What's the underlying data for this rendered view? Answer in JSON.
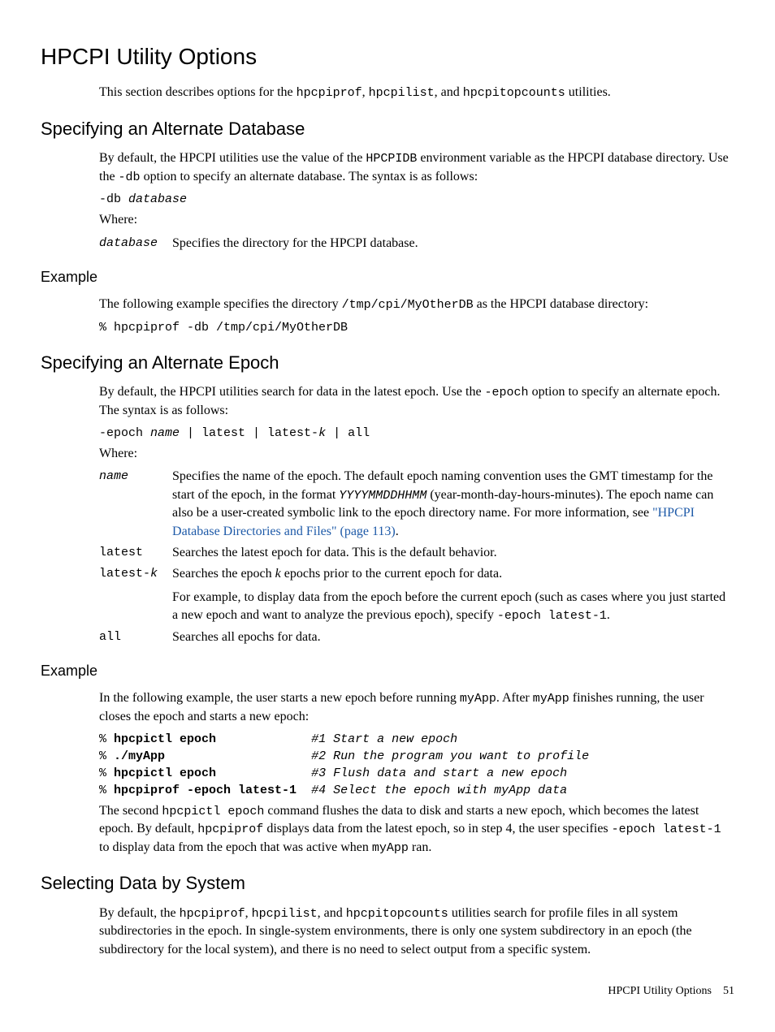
{
  "title": "HPCPI Utility Options",
  "intro_p1": "This section describes options for the ",
  "intro_c1": "hpcpiprof",
  "intro_p2": ", ",
  "intro_c2": "hpcpilist",
  "intro_p3": ", and ",
  "intro_c3": "hpcpitopcounts",
  "intro_p4": " utilities.",
  "sec_db": {
    "heading": "Specifying an Alternate Database",
    "p1a": "By default, the HPCPI utilities use the value of the ",
    "p1b": "HPCPIDB",
    "p1c": " environment variable as the HPCPI database directory. Use the ",
    "p1d": "-db",
    "p1e": " option to specify an alternate database. The syntax is as follows:",
    "syntax_a": "-db ",
    "syntax_b": "database",
    "where": "Where:",
    "term1": "database",
    "desc1": "Specifies the directory for the HPCPI database.",
    "ex_heading": "Example",
    "ex_p1a": "The following example specifies the directory ",
    "ex_p1b": "/tmp/cpi/MyOtherDB",
    "ex_p1c": " as the HPCPI database directory:",
    "ex_code": "% hpcpiprof -db /tmp/cpi/MyOtherDB"
  },
  "sec_epoch": {
    "heading": "Specifying an Alternate Epoch",
    "p1a": "By default, the HPCPI utilities search for data in the latest epoch. Use the ",
    "p1b": "-epoch",
    "p1c": " option to specify an alternate epoch. The syntax is as follows:",
    "syntax_a": "-epoch ",
    "syntax_b": "name",
    "syntax_c": " | latest | latest-",
    "syntax_d": "k",
    "syntax_e": " | all",
    "where": "Where:",
    "t_name": "name",
    "d_name_a": "Specifies the name of the epoch. The default epoch naming convention uses the GMT timestamp for the start of the epoch, in the format ",
    "d_name_b": "YYYYMMDDHHMM",
    "d_name_c": " (year-month-day-hours-minutes). The epoch name can also be a user-created symbolic link to the epoch directory name. For more information, see ",
    "d_name_link": "\"HPCPI Database Directories and Files\" (page 113)",
    "d_name_d": ".",
    "t_latest": "latest",
    "d_latest": "Searches the latest epoch for data. This is the default behavior.",
    "t_latestk_a": "latest-",
    "t_latestk_b": "k",
    "d_latestk_a": "Searches the epoch ",
    "d_latestk_b": "k",
    "d_latestk_c": " epochs prior to the current epoch for data.",
    "d_latestk_2a": "For example, to display data from the epoch before the current epoch (such as cases where you just started a new epoch and want to analyze the previous epoch), specify ",
    "d_latestk_2b": "-epoch latest-1",
    "d_latestk_2c": ".",
    "t_all": "all",
    "d_all": "Searches all epochs for data.",
    "ex_heading": "Example",
    "ex_p1a": "In the following example, the user starts a new epoch before running ",
    "ex_p1b": "myApp",
    "ex_p1c": ". After ",
    "ex_p1d": "myApp",
    "ex_p1e": " finishes running, the user closes the epoch and starts a new epoch:",
    "ex_l1a": "% ",
    "ex_l1b": "hpcpictl epoch",
    "ex_l1c": "             ",
    "ex_l1d": "#1 Start a new epoch",
    "ex_l2a": "% ",
    "ex_l2b": "./myApp",
    "ex_l2c": "                    ",
    "ex_l2d": "#2 Run the program you want to profile",
    "ex_l3a": "% ",
    "ex_l3b": "hpcpictl epoch",
    "ex_l3c": "             ",
    "ex_l3d": "#3 Flush data and start a new epoch",
    "ex_l4a": "% ",
    "ex_l4b": "hpcpiprof -epoch latest-1",
    "ex_l4c": "  ",
    "ex_l4d": "#4 Select the epoch with myApp data",
    "ex_p2a": "The second ",
    "ex_p2b": "hpcpictl epoch",
    "ex_p2c": " command flushes the data to disk and starts a new epoch, which becomes the latest epoch. By default, ",
    "ex_p2d": "hpcpiprof",
    "ex_p2e": " displays data from the latest epoch, so in step 4, the user specifies ",
    "ex_p2f": "-epoch latest-1",
    "ex_p2g": " to display data from the epoch that was active when ",
    "ex_p2h": "myApp",
    "ex_p2i": " ran."
  },
  "sec_sys": {
    "heading": "Selecting Data by System",
    "p1a": "By default, the ",
    "p1b": "hpcpiprof",
    "p1c": ", ",
    "p1d": "hpcpilist",
    "p1e": ", and ",
    "p1f": "hpcpitopcounts",
    "p1g": " utilities search for profile files in all system subdirectories in the epoch. In single-system environments, there is only one system subdirectory in an epoch (the subdirectory for the local system), and there is no need to select output from a specific system."
  },
  "footer": {
    "section": "HPCPI Utility Options",
    "page": "51"
  }
}
